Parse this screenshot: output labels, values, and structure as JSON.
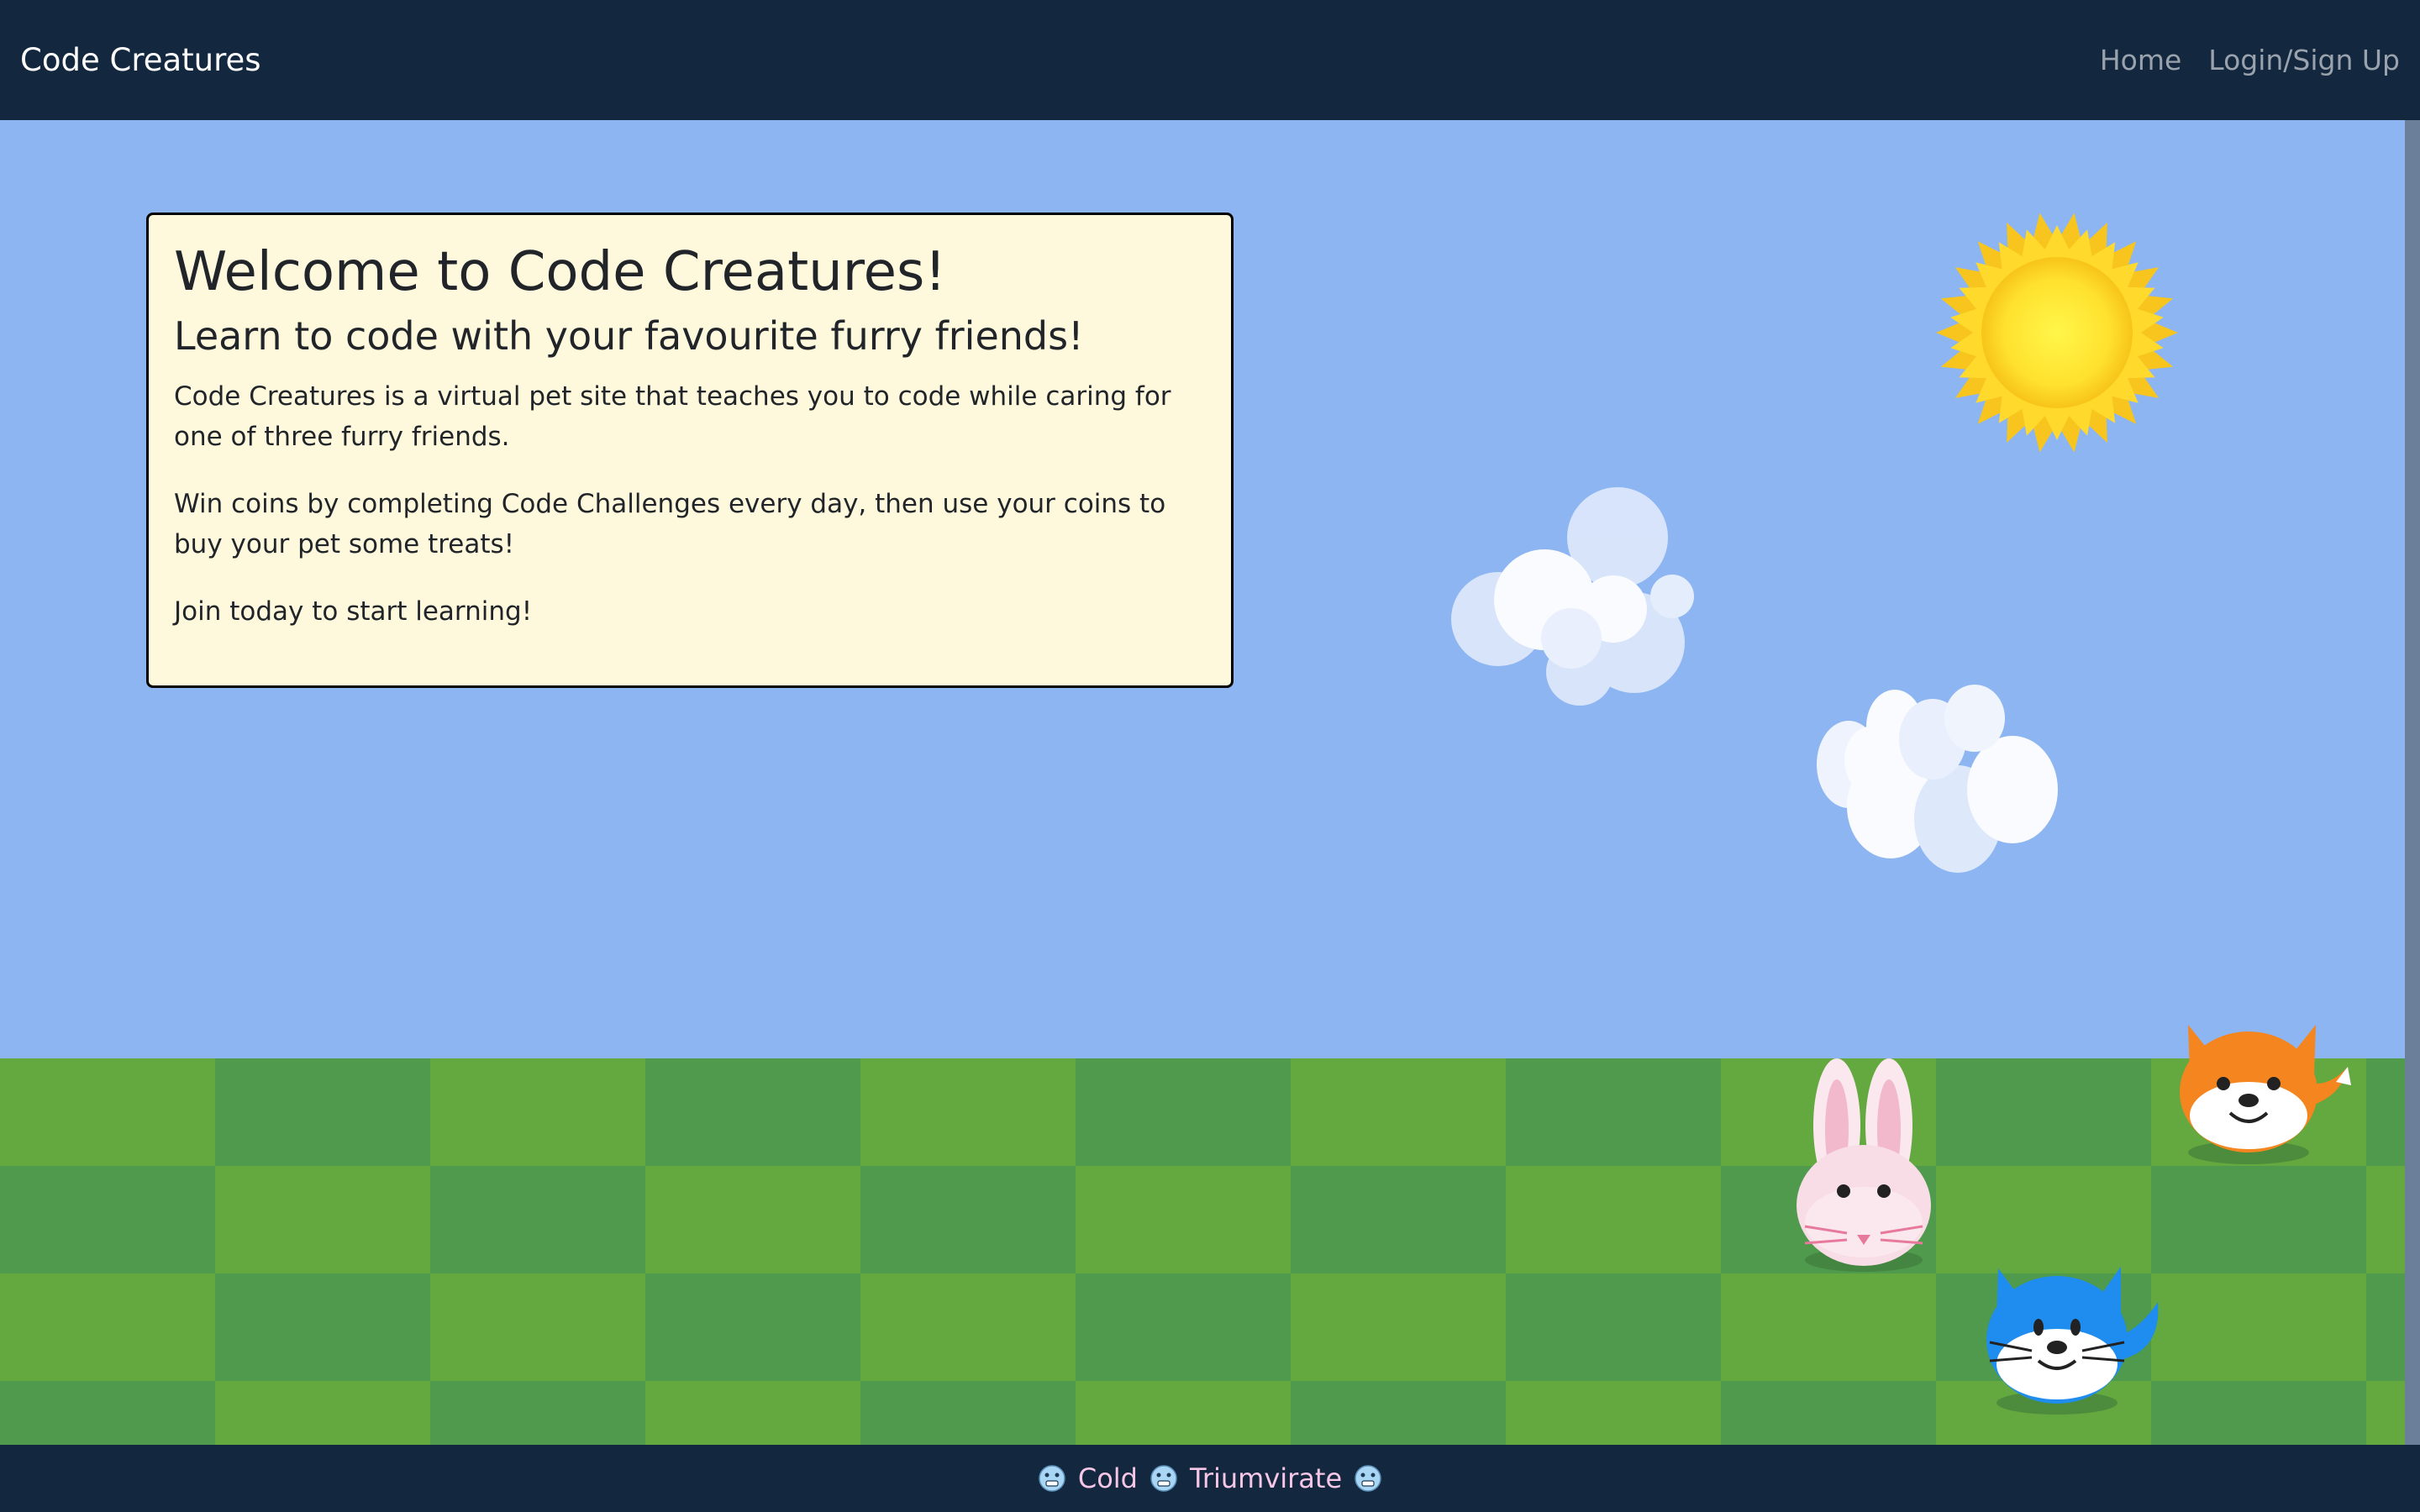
{
  "navbar": {
    "brand": "Code Creatures",
    "links": [
      {
        "label": "Home"
      },
      {
        "label": "Login/Sign Up"
      }
    ]
  },
  "welcome": {
    "title": "Welcome to Code Creatures!",
    "subtitle": "Learn to code with your favourite furry friends!",
    "paragraphs": [
      "Code Creatures is a virtual pet site that teaches you to code while caring for one of three furry friends.",
      "Win coins by completing Code Challenges every day, then use your coins to buy your pet some treats!",
      "Join today to start learning!"
    ]
  },
  "footer": {
    "words": [
      "Cold",
      "Triumvirate"
    ],
    "emoji_icon": "cold-face-icon"
  },
  "colors": {
    "navbar_bg": "#13283f",
    "sky": "#8db5f2",
    "grass_light": "#64a840",
    "grass_dark": "#4f9a4c",
    "card_bg": "#fef8dc",
    "footer_text": "#f5c6e6"
  },
  "creatures": [
    "bunny-icon",
    "fox-icon",
    "cat-icon"
  ]
}
